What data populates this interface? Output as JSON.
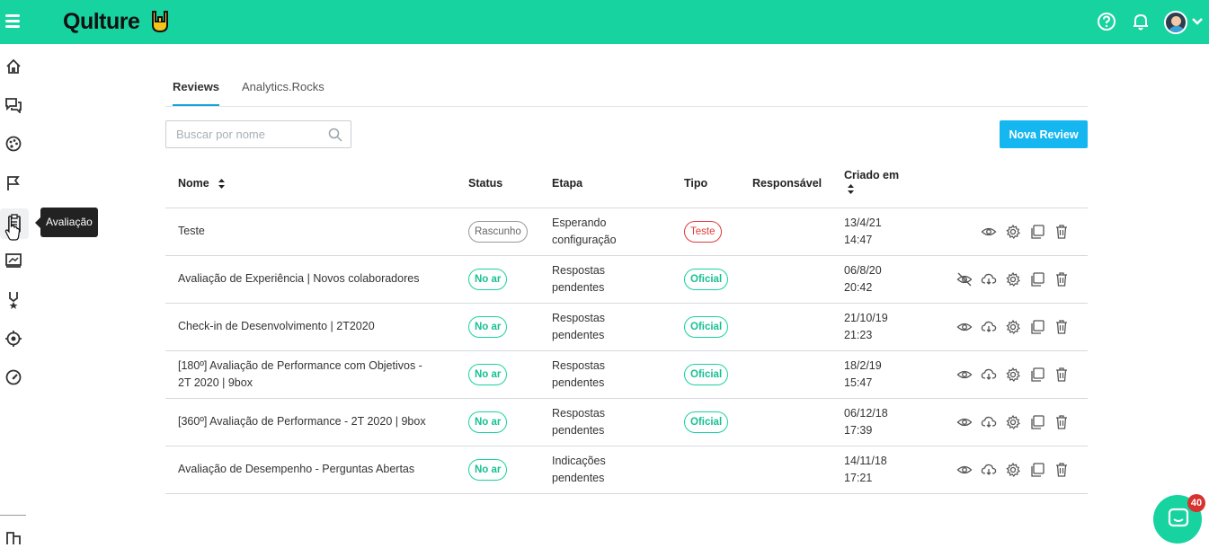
{
  "app": {
    "name": "Qulture"
  },
  "topbar": {
    "icons": [
      "help-icon",
      "bell-icon",
      "avatar",
      "chevron-down-icon"
    ]
  },
  "sidebar": {
    "items": [
      "home-icon",
      "chat-bubbles-icon",
      "palette-icon",
      "flag-icon",
      "clipboard-icon",
      "presentation-icon",
      "medal-icon",
      "target-icon",
      "speedometer-icon"
    ],
    "tooltip": "Avaliação"
  },
  "tabs": [
    {
      "label": "Reviews",
      "active": true
    },
    {
      "label": "Analytics.Rocks",
      "active": false
    }
  ],
  "search": {
    "placeholder": "Buscar por nome"
  },
  "new_button": "Nova Review",
  "table": {
    "headers": {
      "nome": "Nome",
      "status": "Status",
      "etapa": "Etapa",
      "tipo": "Tipo",
      "responsavel": "Responsável",
      "criado": "Criado em"
    },
    "rows": [
      {
        "nome": "Teste",
        "status": "Rascunho",
        "etapa": "Esperando configuração",
        "tipo": "Teste",
        "criado_date": "13/4/21",
        "criado_time": "14:47"
      },
      {
        "nome": "Avaliação de Experiência | Novos colaboradores",
        "status": "No ar",
        "etapa": "Respostas pendentes",
        "tipo": "Oficial",
        "criado_date": "06/8/20",
        "criado_time": "20:42"
      },
      {
        "nome": "Check-in de Desenvolvimento | 2T2020",
        "status": "No ar",
        "etapa": "Respostas pendentes",
        "tipo": "Oficial",
        "criado_date": "21/10/19",
        "criado_time": "21:23"
      },
      {
        "nome": "[180º] Avaliação de Performance com Objetivos - 2T 2020 | 9box",
        "status": "No ar",
        "etapa": "Respostas pendentes",
        "tipo": "Oficial",
        "criado_date": "18/2/19",
        "criado_time": "15:47"
      },
      {
        "nome": "[360º] Avaliação de Performance - 2T 2020 | 9box",
        "status": "No ar",
        "etapa": "Respostas pendentes",
        "tipo": "Oficial",
        "criado_date": "06/12/18",
        "criado_time": "17:39"
      },
      {
        "nome": "Avaliação de Desempenho - Perguntas Abertas",
        "status": "No ar",
        "etapa": "Indicações pendentes",
        "tipo": "",
        "criado_date": "14/11/18",
        "criado_time": "17:21"
      }
    ]
  },
  "chat": {
    "badge": "40"
  },
  "colors": {
    "brand": "#17d3a0",
    "accent": "#16b7f0",
    "danger": "#e03c3c"
  }
}
